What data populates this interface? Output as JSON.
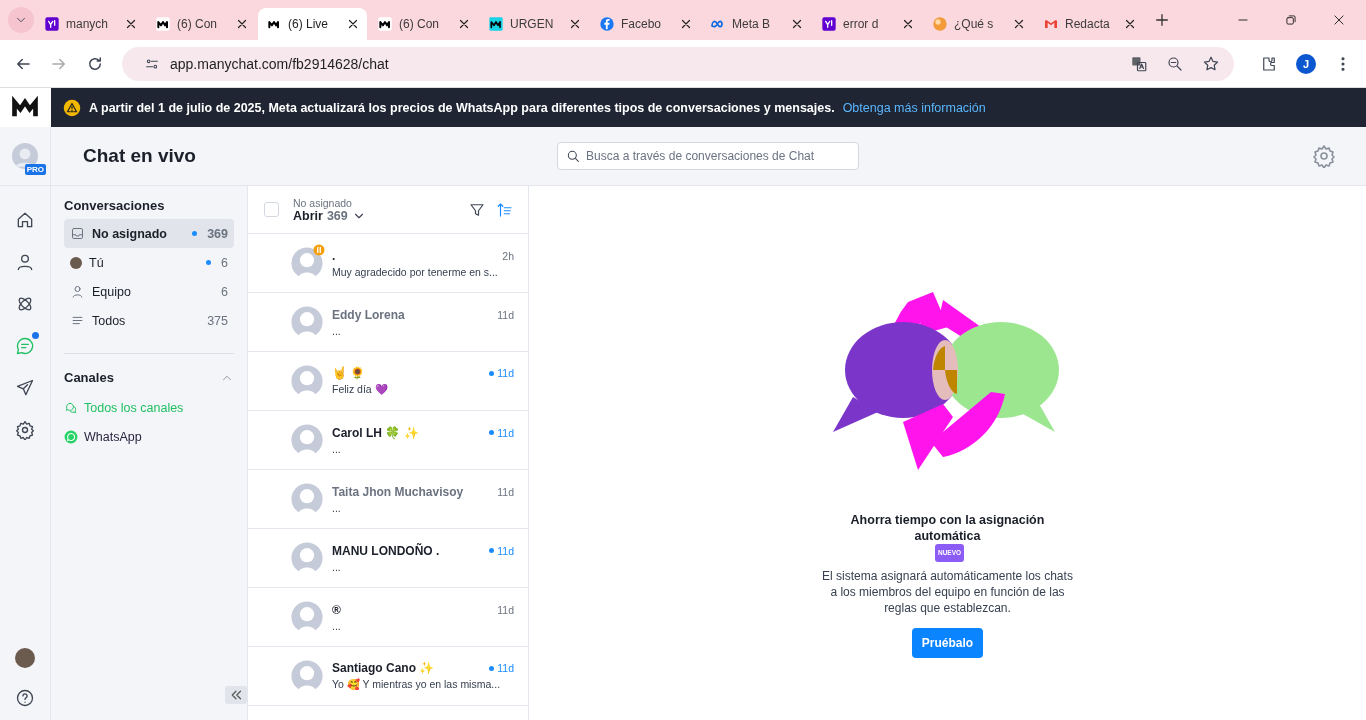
{
  "browser": {
    "tabs": [
      {
        "title": "manych",
        "kind": "yahoo",
        "selected": false
      },
      {
        "title": "(6) Con",
        "kind": "manychat",
        "selected": false
      },
      {
        "title": "(6) Live",
        "kind": "manychat",
        "selected": true
      },
      {
        "title": "(6) Con",
        "kind": "manychat",
        "selected": false
      },
      {
        "title": "URGEN",
        "kind": "cyan",
        "selected": false
      },
      {
        "title": "Facebo",
        "kind": "facebook",
        "selected": false
      },
      {
        "title": "Meta B",
        "kind": "meta",
        "selected": false
      },
      {
        "title": "error d",
        "kind": "yahoo",
        "selected": false
      },
      {
        "title": "¿Qué s",
        "kind": "orb",
        "selected": false
      },
      {
        "title": "Redacta",
        "kind": "gmail",
        "selected": false
      }
    ],
    "url": "app.manychat.com/fb2914628/chat",
    "profile_initial": "J"
  },
  "banner": {
    "text": "A partir del 1 de julio de 2025, Meta actualizará los precios de WhatsApp para diferentes tipos de conversaciones y mensajes.",
    "link": "Obtenga más información"
  },
  "rail": {
    "badge": "PRO",
    "items": [
      {
        "kind": "home",
        "selected": false,
        "dot": false
      },
      {
        "kind": "contacts",
        "selected": false,
        "dot": false
      },
      {
        "kind": "automation",
        "selected": false,
        "dot": false
      },
      {
        "kind": "chat",
        "selected": true,
        "dot": true
      },
      {
        "kind": "broadcast",
        "selected": false,
        "dot": false
      },
      {
        "kind": "settings",
        "selected": false,
        "dot": false
      }
    ]
  },
  "header": {
    "title": "Chat en vivo",
    "search": {
      "placeholder": "Busca a través de conversaciones de Chat"
    }
  },
  "conversations": {
    "heading": "Conversaciones",
    "items": [
      {
        "kind": "inbox",
        "label": "No asignado",
        "count": "369",
        "unread": true,
        "selected": true
      },
      {
        "kind": "avatar",
        "label": "Tú",
        "count": "6",
        "unread": true,
        "selected": false
      },
      {
        "kind": "team",
        "label": "Equipo",
        "count": "6",
        "unread": false,
        "selected": false
      },
      {
        "kind": "all",
        "label": "Todos",
        "count": "375",
        "unread": false,
        "selected": false
      }
    ]
  },
  "channels": {
    "heading": "Canales",
    "expanded": true,
    "items": [
      {
        "kind": "all",
        "label": "Todos los canales",
        "selected": true
      },
      {
        "kind": "whatsapp",
        "label": "WhatsApp",
        "selected": false
      }
    ]
  },
  "list": {
    "checked": false,
    "subtitle": "No asignado",
    "status": "Abrir",
    "count": "369",
    "chats": [
      {
        "name": ".",
        "time": "2h",
        "preview": "Muy agradecido por tenerme en s...",
        "unread": false,
        "bold": true,
        "paused": true
      },
      {
        "name": "Eddy Lorena",
        "time": "11d",
        "preview": "...",
        "unread": false,
        "bold": false,
        "paused": false
      },
      {
        "name": "🤘 🌻",
        "time": "11d",
        "preview": "Feliz día 💜",
        "unread": true,
        "bold": true,
        "paused": false
      },
      {
        "name": "Carol LH 🍀 ✨",
        "time": "11d",
        "preview": "...",
        "unread": true,
        "bold": true,
        "paused": false
      },
      {
        "name": "Taita Jhon Muchavisoy",
        "time": "11d",
        "preview": "...",
        "unread": false,
        "bold": false,
        "paused": false
      },
      {
        "name": "MANU LONDOÑO .",
        "time": "11d",
        "preview": "...",
        "unread": true,
        "bold": true,
        "paused": false
      },
      {
        "name": "®",
        "time": "11d",
        "preview": "...",
        "unread": false,
        "bold": true,
        "paused": false
      },
      {
        "name": "Santiago Cano ✨",
        "time": "11d",
        "preview": "Yo 🥰 Y mientras yo en las misma...",
        "unread": true,
        "bold": true,
        "paused": false
      }
    ]
  },
  "empty": {
    "title": "Ahorra tiempo con la asignación automática",
    "badge": "NUEVO",
    "text": "El sistema asignará automáticamente los chats a los miembros del equipo en función de las reglas que establezcan.",
    "button": "Pruébalo"
  }
}
